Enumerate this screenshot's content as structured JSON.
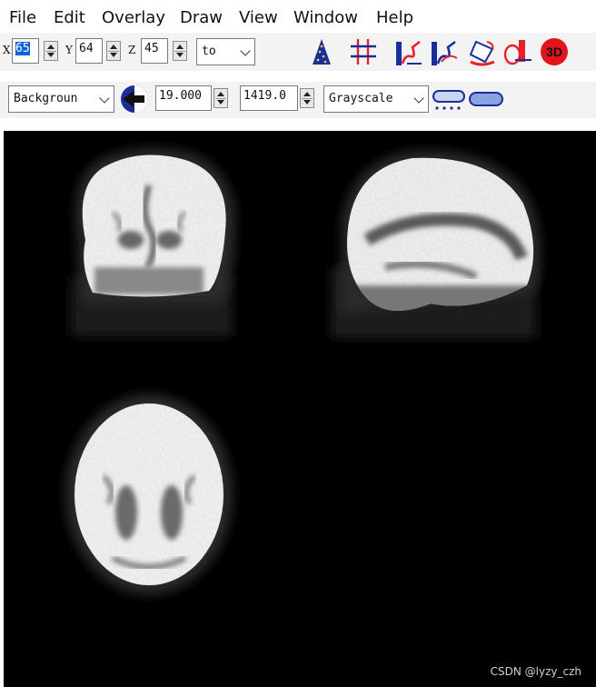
{
  "menu": [
    "File",
    "Edit",
    "Overlay",
    "Draw",
    "View",
    "Window",
    "Help"
  ],
  "coords": {
    "x_label": "X",
    "x_value": "65",
    "y_label": "Y",
    "y_value": "64",
    "z_label": "Z",
    "z_value": "45",
    "to_option": "to"
  },
  "tools": [
    "crosshair-cone-icon",
    "grid-hash-icon",
    "ruler-curve-red-icon",
    "ruler-curve-blue-icon",
    "bucket-fill-icon",
    "pen-eraser-icon",
    "render-3d-icon"
  ],
  "tool_3d_text": "3D",
  "display": {
    "layer": "Backgroun",
    "min_value": "19.000",
    "max_value": "1419.0",
    "colormap": "Grayscale"
  },
  "views": [
    "coronal-slice",
    "sagittal-slice",
    "axial-slice"
  ],
  "watermark": "CSDN @lyzy_czh"
}
